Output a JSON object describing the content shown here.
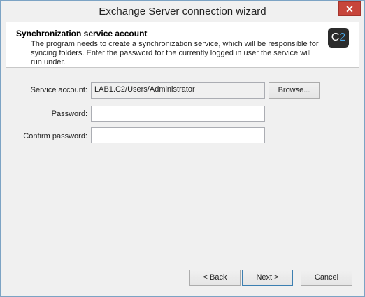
{
  "window": {
    "title": "Exchange Server connection wizard",
    "close_glyph": "✕"
  },
  "header": {
    "title": "Synchronization service account",
    "description": "The program needs to create a synchronization service, which will be responsible for syncing folders. Enter the password for the currently logged in user the service will run under.",
    "logo": {
      "letter": "C",
      "digit": "2"
    }
  },
  "form": {
    "service_account_label": "Service account:",
    "service_account_value": "LAB1.C2/Users/Administrator",
    "browse_label": "Browse...",
    "password_label": "Password:",
    "password_value": "",
    "confirm_password_label": "Confirm password:",
    "confirm_password_value": ""
  },
  "footer": {
    "back_label": "< Back",
    "next_label": "Next >",
    "cancel_label": "Cancel"
  }
}
